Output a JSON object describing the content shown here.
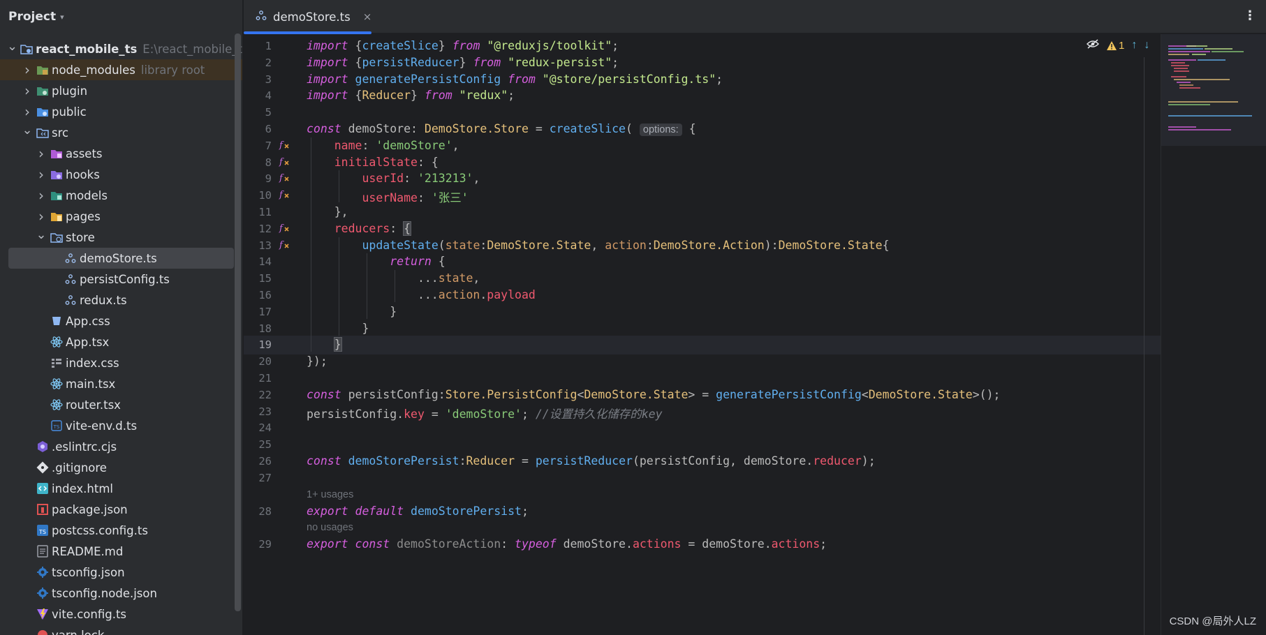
{
  "project": {
    "title": "Project",
    "tree": [
      {
        "label": "react_mobile_ts",
        "hint": "E:\\react_mobile_ts",
        "icon": "project-module-icon",
        "depth": 0,
        "arrow": "open",
        "bold": true
      },
      {
        "label": "node_modules",
        "hint": "library root",
        "icon": "folder-library-icon",
        "depth": 1,
        "arrow": "closed",
        "lib": true
      },
      {
        "label": "plugin",
        "icon": "folder-plugin-icon",
        "depth": 1,
        "arrow": "closed"
      },
      {
        "label": "public",
        "icon": "folder-public-icon",
        "depth": 1,
        "arrow": "closed"
      },
      {
        "label": "src",
        "icon": "folder-source-icon",
        "depth": 1,
        "arrow": "open"
      },
      {
        "label": "assets",
        "icon": "folder-assets-icon",
        "depth": 2,
        "arrow": "closed"
      },
      {
        "label": "hooks",
        "icon": "folder-hooks-icon",
        "depth": 2,
        "arrow": "closed"
      },
      {
        "label": "models",
        "icon": "folder-models-icon",
        "depth": 2,
        "arrow": "closed"
      },
      {
        "label": "pages",
        "icon": "folder-pages-icon",
        "depth": 2,
        "arrow": "closed"
      },
      {
        "label": "store",
        "icon": "folder-store-icon",
        "depth": 2,
        "arrow": "open"
      },
      {
        "label": "demoStore.ts",
        "icon": "redux-file-icon",
        "depth": 3,
        "selected": true
      },
      {
        "label": "persistConfig.ts",
        "icon": "redux-file-icon",
        "depth": 3
      },
      {
        "label": "redux.ts",
        "icon": "redux-file-icon",
        "depth": 3
      },
      {
        "label": "App.css",
        "icon": "css-file-icon",
        "depth": 2
      },
      {
        "label": "App.tsx",
        "icon": "react-file-icon",
        "depth": 2
      },
      {
        "label": "index.css",
        "icon": "css-list-icon",
        "depth": 2
      },
      {
        "label": "main.tsx",
        "icon": "react-file-icon",
        "depth": 2
      },
      {
        "label": "router.tsx",
        "icon": "react-file-icon",
        "depth": 2
      },
      {
        "label": "vite-env.d.ts",
        "icon": "typescript-def-icon",
        "depth": 2
      },
      {
        "label": ".eslintrc.cjs",
        "icon": "eslint-icon",
        "depth": 1
      },
      {
        "label": ".gitignore",
        "icon": "git-icon",
        "depth": 1
      },
      {
        "label": "index.html",
        "icon": "html-file-icon",
        "depth": 1
      },
      {
        "label": "package.json",
        "icon": "npm-icon",
        "depth": 1
      },
      {
        "label": "postcss.config.ts",
        "icon": "typescript-file-icon",
        "depth": 1
      },
      {
        "label": "README.md",
        "icon": "markdown-icon",
        "depth": 1
      },
      {
        "label": "tsconfig.json",
        "icon": "tsconfig-icon",
        "depth": 1
      },
      {
        "label": "tsconfig.node.json",
        "icon": "tsconfig-icon",
        "depth": 1
      },
      {
        "label": "vite.config.ts",
        "icon": "vite-icon",
        "depth": 1
      },
      {
        "label": "yarn.lock",
        "icon": "yarn-icon",
        "depth": 1
      }
    ]
  },
  "tabs": {
    "active": "demoStore.ts",
    "close_glyph": "×",
    "menu_glyph": "⋮"
  },
  "inspections": {
    "warnings": "1"
  },
  "editor": {
    "current_line": 19,
    "usage_hints": [
      {
        "before_line": 28,
        "text": "1+ usages"
      },
      {
        "before_line": 29,
        "text": "no usages"
      }
    ],
    "lines": [
      {
        "n": 1,
        "tokens": [
          [
            "kwi",
            "import"
          ],
          [
            "plain",
            " {"
          ],
          [
            "fn",
            "createSlice"
          ],
          [
            "plain",
            "} "
          ],
          [
            "kwi",
            "from"
          ],
          [
            "plain",
            " "
          ],
          [
            "str",
            "\"@reduxjs/toolkit\""
          ],
          [
            "plain",
            ";"
          ]
        ]
      },
      {
        "n": 2,
        "tokens": [
          [
            "kwi",
            "import"
          ],
          [
            "plain",
            " {"
          ],
          [
            "fn",
            "persistReducer"
          ],
          [
            "plain",
            "} "
          ],
          [
            "kwi",
            "from"
          ],
          [
            "plain",
            " "
          ],
          [
            "str",
            "\"redux-persist\""
          ],
          [
            "plain",
            ";"
          ]
        ]
      },
      {
        "n": 3,
        "tokens": [
          [
            "kwi",
            "import"
          ],
          [
            "plain",
            " "
          ],
          [
            "fn",
            "generatePersistConfig"
          ],
          [
            "plain",
            " "
          ],
          [
            "kwi",
            "from"
          ],
          [
            "plain",
            " "
          ],
          [
            "str",
            "\"@store/persistConfig.ts\""
          ],
          [
            "plain",
            ";"
          ]
        ]
      },
      {
        "n": 4,
        "tokens": [
          [
            "kwi",
            "import"
          ],
          [
            "plain",
            " {"
          ],
          [
            "type",
            "Reducer"
          ],
          [
            "plain",
            "} "
          ],
          [
            "kwi",
            "from"
          ],
          [
            "plain",
            " "
          ],
          [
            "str",
            "\"redux\""
          ],
          [
            "plain",
            ";"
          ]
        ]
      },
      {
        "n": 5,
        "tokens": []
      },
      {
        "n": 6,
        "tokens": [
          [
            "kwi",
            "const"
          ],
          [
            "plain",
            " demoStore: "
          ],
          [
            "type",
            "DemoStore.Store"
          ],
          [
            "plain",
            " = "
          ],
          [
            "fn",
            "createSlice"
          ],
          [
            "plain",
            "( "
          ],
          [
            "hint",
            "options:"
          ],
          [
            "plain",
            " {"
          ]
        ]
      },
      {
        "n": 7,
        "gutter": true,
        "tokens": [
          [
            "plain",
            "    "
          ],
          [
            "prop",
            "name"
          ],
          [
            "plain",
            ": "
          ],
          [
            "str2",
            "'demoStore'"
          ],
          [
            "plain",
            ","
          ]
        ]
      },
      {
        "n": 8,
        "gutter": true,
        "tokens": [
          [
            "plain",
            "    "
          ],
          [
            "prop",
            "initialState"
          ],
          [
            "plain",
            ": {"
          ]
        ]
      },
      {
        "n": 9,
        "gutter": true,
        "tokens": [
          [
            "plain",
            "        "
          ],
          [
            "prop",
            "userId"
          ],
          [
            "plain",
            ": "
          ],
          [
            "str2",
            "'213213'"
          ],
          [
            "plain",
            ","
          ]
        ]
      },
      {
        "n": 10,
        "gutter": true,
        "tokens": [
          [
            "plain",
            "        "
          ],
          [
            "prop",
            "userName"
          ],
          [
            "plain",
            ": "
          ],
          [
            "str2",
            "'张三'"
          ]
        ]
      },
      {
        "n": 11,
        "tokens": [
          [
            "plain",
            "    },"
          ]
        ]
      },
      {
        "n": 12,
        "gutter": true,
        "tokens": [
          [
            "plain",
            "    "
          ],
          [
            "prop",
            "reducers"
          ],
          [
            "plain",
            ": "
          ],
          [
            "brace",
            "{"
          ]
        ]
      },
      {
        "n": 13,
        "gutter": true,
        "tokens": [
          [
            "plain",
            "        "
          ],
          [
            "fn",
            "updateState"
          ],
          [
            "plain",
            "("
          ],
          [
            "param",
            "state"
          ],
          [
            "plain",
            ":"
          ],
          [
            "type",
            "DemoStore.State"
          ],
          [
            "plain",
            ", "
          ],
          [
            "param",
            "action"
          ],
          [
            "plain",
            ":"
          ],
          [
            "type",
            "DemoStore.Action"
          ],
          [
            "plain",
            "):"
          ],
          [
            "type",
            "DemoStore.State"
          ],
          [
            "plain",
            "{"
          ]
        ]
      },
      {
        "n": 14,
        "tokens": [
          [
            "plain",
            "            "
          ],
          [
            "kwi",
            "return"
          ],
          [
            "plain",
            " {"
          ]
        ]
      },
      {
        "n": 15,
        "tokens": [
          [
            "plain",
            "                ..."
          ],
          [
            "param",
            "state"
          ],
          [
            "plain",
            ","
          ]
        ]
      },
      {
        "n": 16,
        "tokens": [
          [
            "plain",
            "                ..."
          ],
          [
            "param",
            "action"
          ],
          [
            "plain",
            "."
          ],
          [
            "prop",
            "payload"
          ]
        ]
      },
      {
        "n": 17,
        "tokens": [
          [
            "plain",
            "            }"
          ]
        ]
      },
      {
        "n": 18,
        "tokens": [
          [
            "plain",
            "        }"
          ]
        ]
      },
      {
        "n": 19,
        "tokens": [
          [
            "plain",
            "    "
          ],
          [
            "brace",
            "}"
          ]
        ]
      },
      {
        "n": 20,
        "tokens": [
          [
            "plain",
            "});"
          ]
        ]
      },
      {
        "n": 21,
        "tokens": []
      },
      {
        "n": 22,
        "tokens": [
          [
            "kwi",
            "const"
          ],
          [
            "plain",
            " persistConfig:"
          ],
          [
            "type",
            "Store.PersistConfig"
          ],
          [
            "plain",
            "<"
          ],
          [
            "type",
            "DemoStore.State"
          ],
          [
            "plain",
            "> = "
          ],
          [
            "fn",
            "generatePersistConfig"
          ],
          [
            "plain",
            "<"
          ],
          [
            "type",
            "DemoStore.State"
          ],
          [
            "plain",
            ">();"
          ]
        ]
      },
      {
        "n": 23,
        "tokens": [
          [
            "plain",
            "persistConfig."
          ],
          [
            "prop",
            "key"
          ],
          [
            "plain",
            " = "
          ],
          [
            "str2",
            "'demoStore'"
          ],
          [
            "plain",
            "; "
          ],
          [
            "cmt",
            "//设置持久化储存的key"
          ]
        ]
      },
      {
        "n": 24,
        "tokens": []
      },
      {
        "n": 25,
        "tokens": []
      },
      {
        "n": 26,
        "tokens": [
          [
            "kwi",
            "const"
          ],
          [
            "plain",
            " "
          ],
          [
            "fn",
            "demoStorePersist"
          ],
          [
            "plain",
            ":"
          ],
          [
            "type",
            "Reducer"
          ],
          [
            "plain",
            " = "
          ],
          [
            "fn",
            "persistReducer"
          ],
          [
            "plain",
            "(persistConfig, demoStore."
          ],
          [
            "prop",
            "reducer"
          ],
          [
            "plain",
            ");"
          ]
        ]
      },
      {
        "n": 27,
        "tokens": []
      },
      {
        "n": 28,
        "tokens": [
          [
            "kwi",
            "export"
          ],
          [
            "plain",
            " "
          ],
          [
            "kwi",
            "default"
          ],
          [
            "plain",
            " "
          ],
          [
            "fn",
            "demoStorePersist"
          ],
          [
            "plain",
            ";"
          ]
        ]
      },
      {
        "n": 29,
        "tokens": [
          [
            "kwi",
            "export"
          ],
          [
            "plain",
            " "
          ],
          [
            "kwi",
            "const"
          ],
          [
            "plain",
            " "
          ],
          [
            "dim",
            "demoStoreAction"
          ],
          [
            "plain",
            ": "
          ],
          [
            "kwi",
            "typeof"
          ],
          [
            "plain",
            " demoStore."
          ],
          [
            "prop",
            "actions"
          ],
          [
            "plain",
            " = demoStore."
          ],
          [
            "prop",
            "actions"
          ],
          [
            "plain",
            ";"
          ]
        ]
      }
    ]
  },
  "colors": {
    "accent": "#3574f0",
    "keyword": "#d55fde",
    "string": "#89ca78",
    "function": "#61afef",
    "property": "#ef596f",
    "type": "#e5c07b"
  },
  "watermark": "CSDN @局外人LZ"
}
